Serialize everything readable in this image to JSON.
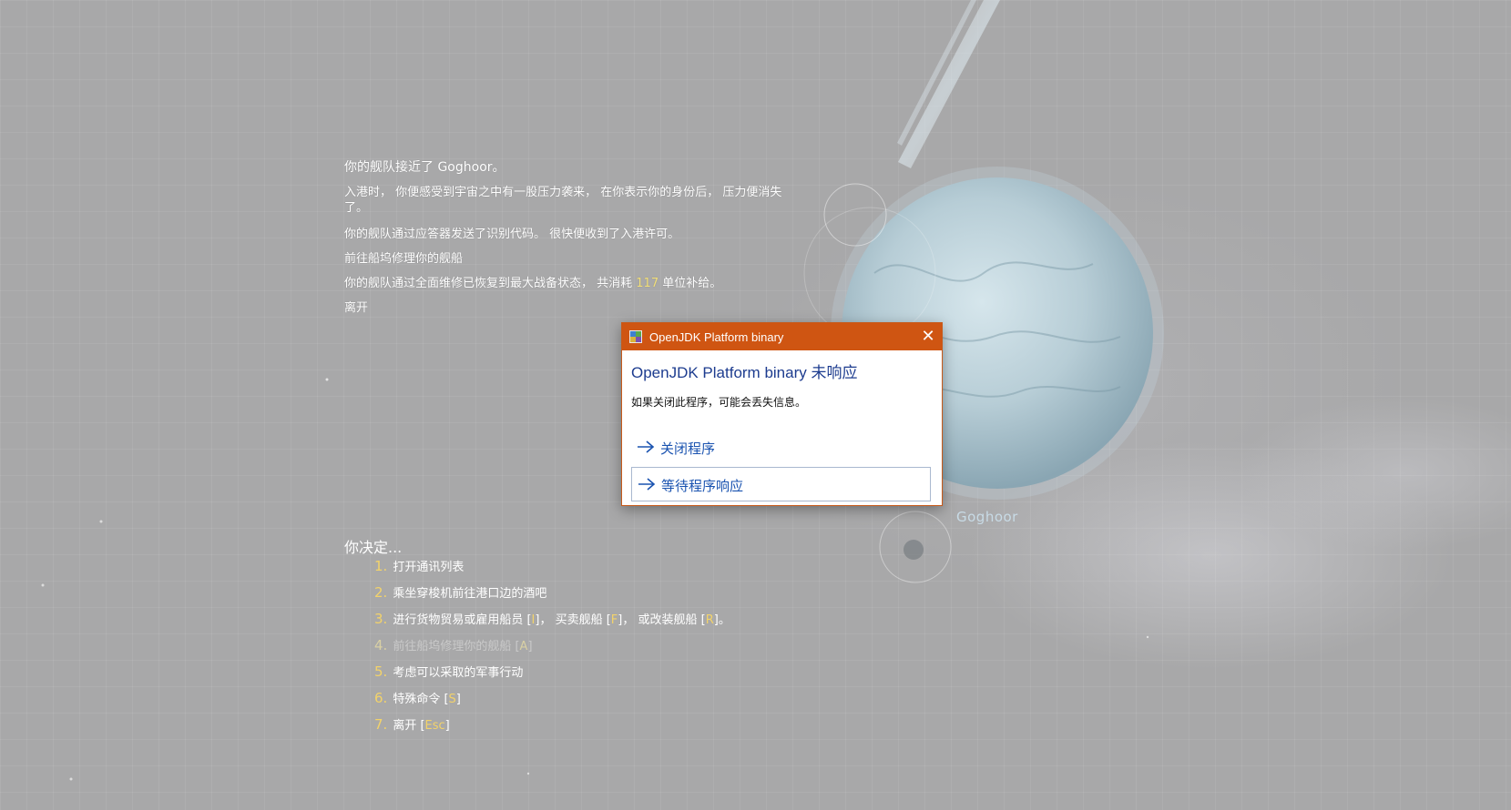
{
  "narrative": {
    "p1": "你的舰队接近了 Goghoor。",
    "p2": "入港时， 你便感受到宇宙之中有一股压力袭来， 在你表示你的身份后， 压力便消失了。",
    "p3": "你的舰队通过应答器发送了识别代码。 很快便收到了入港许可。",
    "p4": "前往船坞修理你的舰船",
    "p5_pre": "你的舰队通过全面维修已恢复到最大战备状态， 共消耗",
    "p5_num": "117",
    "p5_post": "单位补给。",
    "p6": "离开"
  },
  "planet_label": "Goghoor",
  "decide_title": "你决定...",
  "options": [
    {
      "num": "1.",
      "text": "打开通讯列表"
    },
    {
      "num": "2.",
      "text": "乘坐穿梭机前往港口边的酒吧"
    },
    {
      "num": "3.",
      "text_a": "进行货物贸易或雇用船员 [",
      "key_a": "I",
      "text_b": "]， 买卖舰船 [",
      "key_b": "F",
      "text_c": "]， 或改装舰船 [",
      "key_c": "R",
      "text_d": "]。"
    },
    {
      "num": "4.",
      "text": "前往船坞修理你的舰船 [",
      "key": "A",
      "suffix": "]",
      "disabled": true
    },
    {
      "num": "5.",
      "text": "考虑可以采取的军事行动"
    },
    {
      "num": "6.",
      "text": "特殊命令 [",
      "key": "S",
      "suffix": "]"
    },
    {
      "num": "7.",
      "text": "离开 [",
      "key": "Esc",
      "suffix": "]"
    }
  ],
  "dialog": {
    "title": "OpenJDK Platform binary",
    "heading": "OpenJDK Platform binary 未响应",
    "message": "如果关闭此程序，可能会丢失信息。",
    "close_glyph": "✕",
    "commands": [
      "关闭程序",
      "等待程序响应"
    ],
    "accent_color": "#cf5512",
    "link_color": "#1a53b0"
  },
  "colors": {
    "background": "#a8a8a9",
    "highlight": "#f3e07a"
  }
}
